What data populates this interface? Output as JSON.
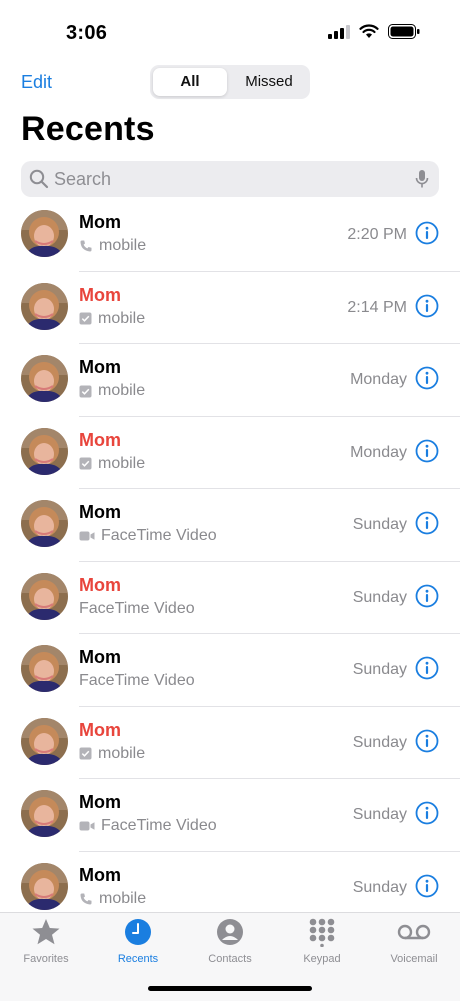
{
  "status": {
    "time": "3:06"
  },
  "nav": {
    "edit": "Edit",
    "segments": [
      "All",
      "Missed"
    ]
  },
  "title": "Recents",
  "search": {
    "placeholder": "Search"
  },
  "calls": [
    {
      "name": "Mom",
      "missed": false,
      "type": "mobile",
      "type_icon": "phone-icon",
      "time": "2:20 PM"
    },
    {
      "name": "Mom",
      "missed": true,
      "type": "mobile",
      "type_icon": "checkbox-icon",
      "time": "2:14 PM"
    },
    {
      "name": "Mom",
      "missed": false,
      "type": "mobile",
      "type_icon": "checkbox-icon",
      "time": "Monday"
    },
    {
      "name": "Mom",
      "missed": true,
      "type": "mobile",
      "type_icon": "checkbox-icon",
      "time": "Monday"
    },
    {
      "name": "Mom",
      "missed": false,
      "type": "FaceTime Video",
      "type_icon": "video-icon",
      "time": "Sunday"
    },
    {
      "name": "Mom",
      "missed": true,
      "type": "FaceTime Video",
      "type_icon": "",
      "time": "Sunday"
    },
    {
      "name": "Mom",
      "missed": false,
      "type": "FaceTime Video",
      "type_icon": "",
      "time": "Sunday"
    },
    {
      "name": "Mom",
      "missed": true,
      "type": "mobile",
      "type_icon": "checkbox-icon",
      "time": "Sunday"
    },
    {
      "name": "Mom",
      "missed": false,
      "type": "FaceTime Video",
      "type_icon": "video-icon",
      "time": "Sunday"
    },
    {
      "name": "Mom",
      "missed": false,
      "type": "mobile",
      "type_icon": "phone-icon",
      "time": "Sunday"
    }
  ],
  "tabs": [
    {
      "label": "Favorites",
      "icon": "star-icon",
      "active": false
    },
    {
      "label": "Recents",
      "icon": "clock-icon",
      "active": true
    },
    {
      "label": "Contacts",
      "icon": "person-icon",
      "active": false
    },
    {
      "label": "Keypad",
      "icon": "keypad-icon",
      "active": false
    },
    {
      "label": "Voicemail",
      "icon": "voicemail-icon",
      "active": false
    }
  ],
  "colors": {
    "accent": "#1a7ee0",
    "missed": "#e8453c",
    "secondary": "#8a8a8e"
  }
}
